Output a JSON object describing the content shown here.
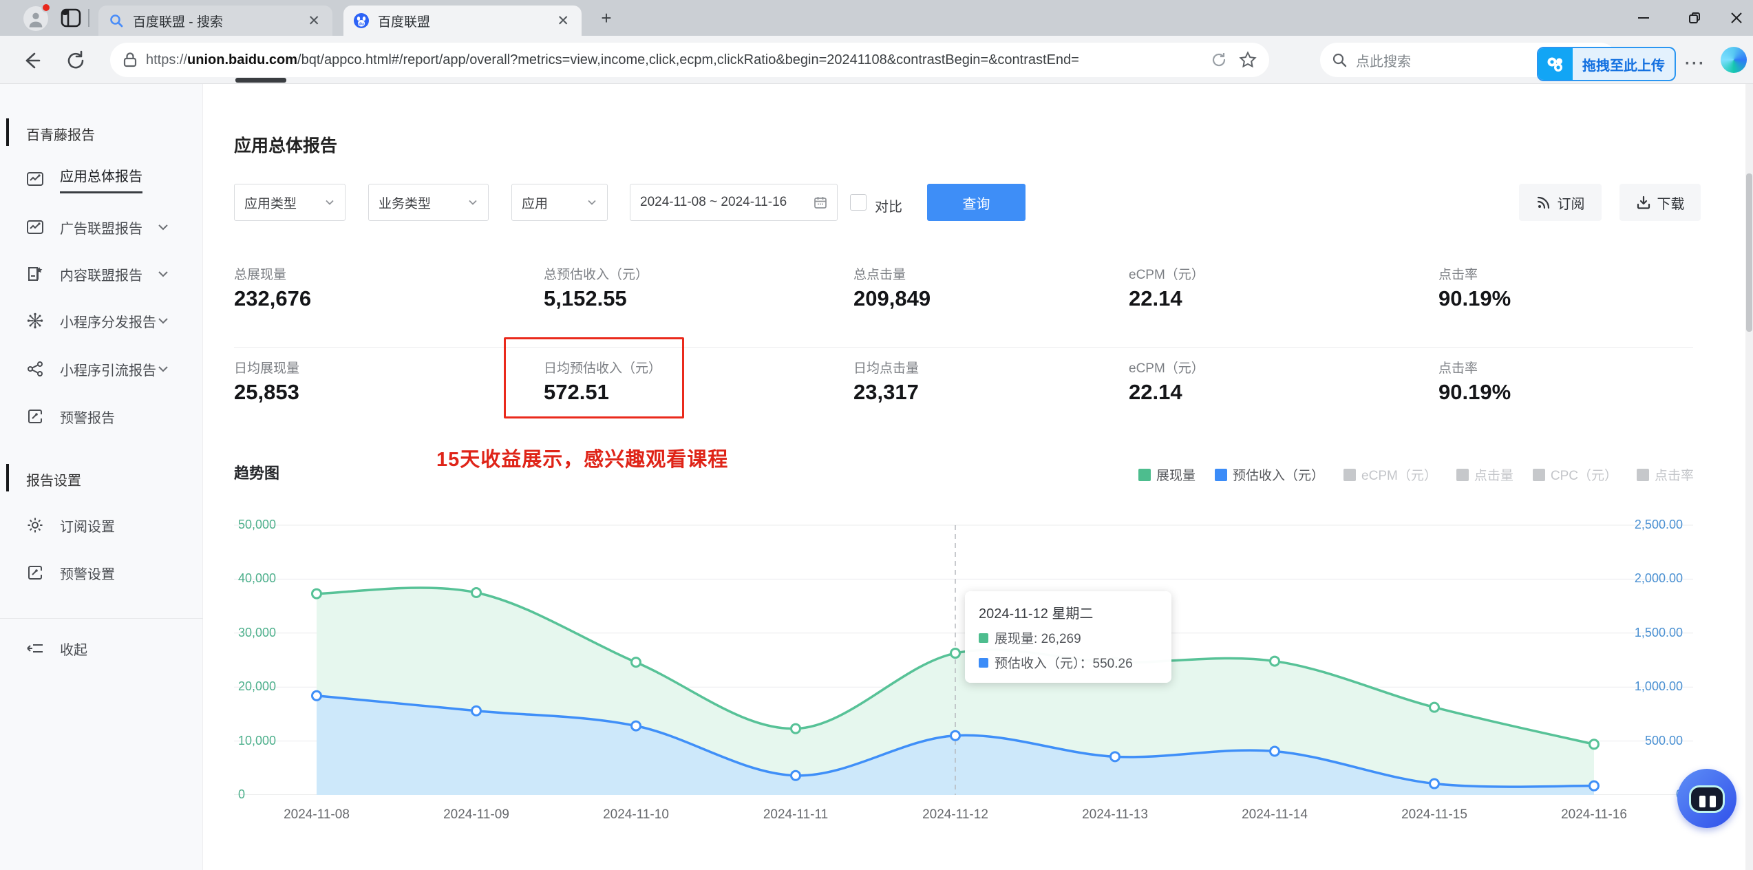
{
  "browser": {
    "tabs": [
      {
        "title": "百度联盟 - 搜索"
      },
      {
        "title": "百度联盟"
      }
    ],
    "new_tab": "+",
    "url": {
      "protocol": "https://",
      "domain": "union.baidu.com",
      "path": "/bqt/appco.html#/report/app/overall?metrics=view,income,click,ecpm,clickRatio&begin=20241108&contrastBegin=&contrastEnd="
    },
    "search_placeholder": "点此搜索",
    "upload_button": "拖拽至此上传",
    "menu_dots": "···"
  },
  "sidebar": {
    "section_report": "百青藤报告",
    "items": [
      {
        "label": "应用总体报告"
      },
      {
        "label": "广告联盟报告"
      },
      {
        "label": "内容联盟报告"
      },
      {
        "label": "小程序分发报告"
      },
      {
        "label": "小程序引流报告"
      },
      {
        "label": "预警报告"
      }
    ],
    "section_settings": "报告设置",
    "settings": [
      {
        "label": "订阅设置"
      },
      {
        "label": "预警设置"
      }
    ],
    "collapse": "收起"
  },
  "main": {
    "title": "应用总体报告",
    "filters": {
      "app_type": "应用类型",
      "biz_type": "业务类型",
      "app": "应用",
      "date_range": "2024-11-08 ~ 2024-11-16",
      "contrast": "对比",
      "query": "查询",
      "subscribe": "订阅",
      "download": "下载"
    },
    "stats_row1": [
      {
        "label": "总展现量",
        "value": "232,676"
      },
      {
        "label": "总预估收入（元）",
        "value": "5,152.55"
      },
      {
        "label": "总点击量",
        "value": "209,849"
      },
      {
        "label": "eCPM（元）",
        "value": "22.14"
      },
      {
        "label": "点击率",
        "value": "90.19%"
      }
    ],
    "stats_row2": [
      {
        "label": "日均展现量",
        "value": "25,853"
      },
      {
        "label": "日均预估收入（元）",
        "value": "572.51"
      },
      {
        "label": "日均点击量",
        "value": "23,317"
      },
      {
        "label": "eCPM（元）",
        "value": "22.14"
      },
      {
        "label": "点击率",
        "value": "90.19%"
      }
    ],
    "annotation": "15天收益展示，感兴趣观看课程",
    "chart_title": "趋势图"
  },
  "chart_data": {
    "type": "area",
    "title": "趋势图",
    "categories": [
      "2024-11-08",
      "2024-11-09",
      "2024-11-10",
      "2024-11-11",
      "2024-11-12",
      "2024-11-13",
      "2024-11-14",
      "2024-11-15",
      "2024-11-16"
    ],
    "series": [
      {
        "name": "展现量",
        "axis": "left",
        "color": "#57c297",
        "fill": "#e6f7ee",
        "values": [
          37300,
          37500,
          24600,
          12300,
          26269,
          24600,
          24800,
          16250,
          9400
        ]
      },
      {
        "name": "预估收入（元）",
        "axis": "right",
        "color": "#3f8ff8",
        "fill": "#cde8fa",
        "values": [
          920,
          780,
          640,
          180,
          550.26,
          355,
          405,
          105,
          85
        ]
      }
    ],
    "left_axis": {
      "max": 50000,
      "ticks": [
        "50,000",
        "40,000",
        "30,000",
        "20,000",
        "10,000",
        "0"
      ],
      "color": "#4caf8b"
    },
    "right_axis": {
      "max": 2500,
      "ticks": [
        "2,500.00",
        "2,000.00",
        "1,500.00",
        "1,000.00",
        "500.00",
        "0"
      ],
      "color": "#4a90d2"
    },
    "legend": [
      {
        "label": "展现量",
        "color": "#4dbd8e",
        "active": true
      },
      {
        "label": "预估收入（元）",
        "color": "#3b8cf8",
        "active": true
      },
      {
        "label": "eCPM（元）",
        "color": "#c6c8cb",
        "active": false
      },
      {
        "label": "点击量",
        "color": "#c6c8cb",
        "active": false
      },
      {
        "label": "CPC（元）",
        "color": "#c6c8cb",
        "active": false
      },
      {
        "label": "点击率",
        "color": "#c6c8cb",
        "active": false
      }
    ],
    "legend_position": "top-right",
    "grid": true,
    "highlight_index": 4
  },
  "tooltip": {
    "date": "2024-11-12 星期二",
    "rows": [
      {
        "label": "展现量",
        "sep": ": ",
        "value": "26,269",
        "color": "#4dbd8e"
      },
      {
        "label": "预估收入（元）",
        "sep": "：",
        "value": "550.26",
        "color": "#3b8cf8"
      }
    ]
  }
}
